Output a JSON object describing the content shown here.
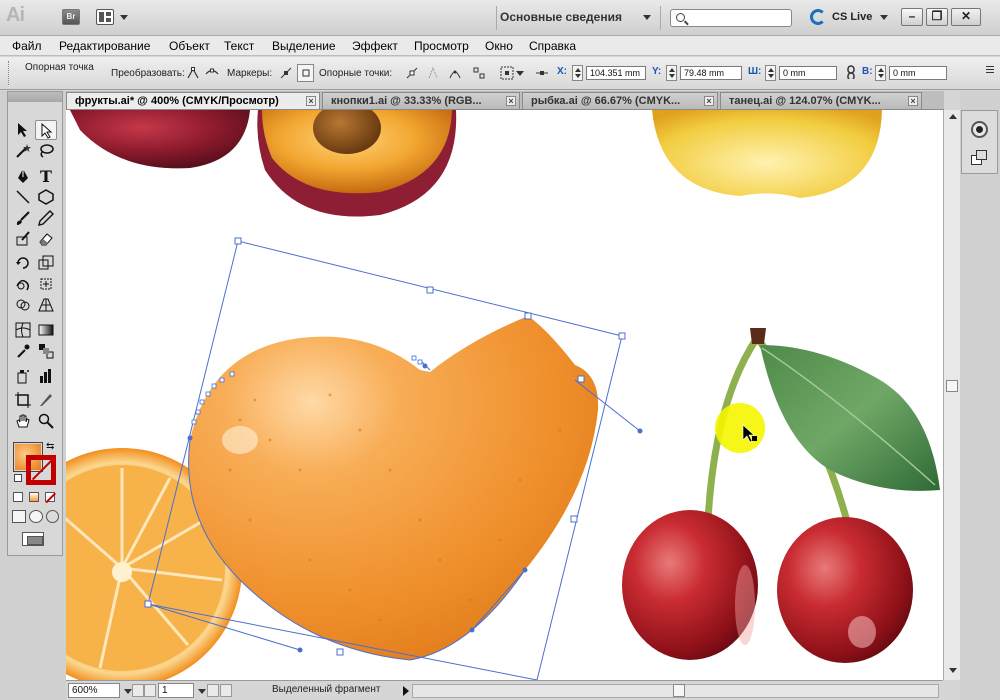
{
  "app": {
    "logo": "Ai",
    "bridge_label": "Br",
    "workspace": "Основные сведения",
    "search_placeholder": "",
    "cslive": "CS Live"
  },
  "menu": [
    "Файл",
    "Редактирование",
    "Объект",
    "Текст",
    "Выделение",
    "Эффект",
    "Просмотр",
    "Окно",
    "Справка"
  ],
  "control": {
    "anchor_label": "Опорная точка",
    "convert_label": "Преобразовать:",
    "handles_label": "Маркеры:",
    "anchors_label": "Опорные точки:",
    "x_label": "X:",
    "x_value": "104.351 mm",
    "y_label": "Y:",
    "y_value": "79.48 mm",
    "w_label": "Ш:",
    "w_value": "0 mm",
    "h_label": "В:",
    "h_value": "0 mm"
  },
  "tabs": [
    {
      "label": "фрукты.ai* @ 400% (CMYK/Просмотр)",
      "active": true
    },
    {
      "label": "кнопки1.ai @ 33.33% (RGB...",
      "active": false
    },
    {
      "label": "рыбка.ai @ 66.67% (CMYK...",
      "active": false
    },
    {
      "label": "танец.ai @ 124.07% (CMYK...",
      "active": false
    }
  ],
  "tab_close": "×",
  "status": {
    "zoom": "600%",
    "page": "1",
    "status_text": "Выделенный фрагмент"
  },
  "colors": {
    "fill_swatch": "#f08a24",
    "accent_blue": "#1f6ec0",
    "selection_path": "#4a6fd0"
  },
  "icons": {
    "selection": "arrow-icon",
    "direct_selection": "direct-selection-icon",
    "search": "search-icon",
    "cslive": "cslive-icon"
  }
}
